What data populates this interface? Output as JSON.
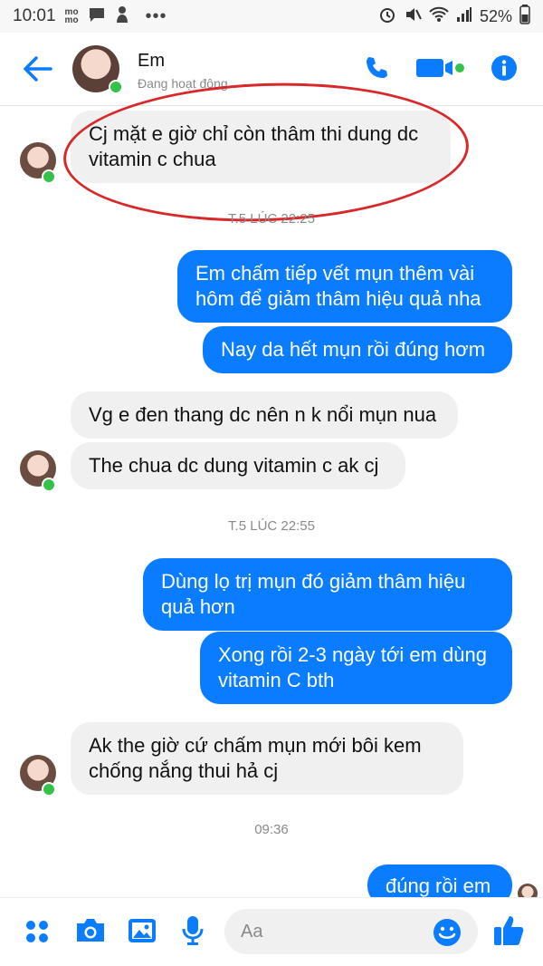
{
  "status_bar": {
    "time": "10:01",
    "mini_top": "mo",
    "mini_bottom": "mo",
    "dots": "•••",
    "battery": "52%"
  },
  "header": {
    "name": "Em",
    "status": "Đang hoạt động"
  },
  "messages": [
    {
      "text": "Cj mặt e giờ chỉ còn thâm thi dung dc vitamin c chua"
    },
    {
      "text": "T.5 LÚC 22:25"
    },
    {
      "text": "Em chấm tiếp vết mụn thêm vài hôm để giảm thâm hiệu quả nha"
    },
    {
      "text": "Nay da hết mụn rồi đúng hơm"
    },
    {
      "text": "Vg e đen thang dc nên n k nổi mụn nua"
    },
    {
      "text": "The chua dc dung vitamin c ak cj"
    },
    {
      "text": "T.5 LÚC 22:55"
    },
    {
      "text": "Dùng lọ trị mụn đó giảm thâm hiệu quả hơn"
    },
    {
      "text": "Xong rồi 2-3 ngày tới em dùng vitamin C bth"
    },
    {
      "text": "Ak the giờ cứ chấm mụn mới bôi kem chống nắng thui hả cj"
    },
    {
      "text": "09:36"
    },
    {
      "text": "đúng rồi em"
    }
  ],
  "composer": {
    "placeholder": "Aa"
  },
  "colors": {
    "accent": "#0a7cff",
    "online": "#35c24a",
    "annotation": "#d8282a"
  }
}
